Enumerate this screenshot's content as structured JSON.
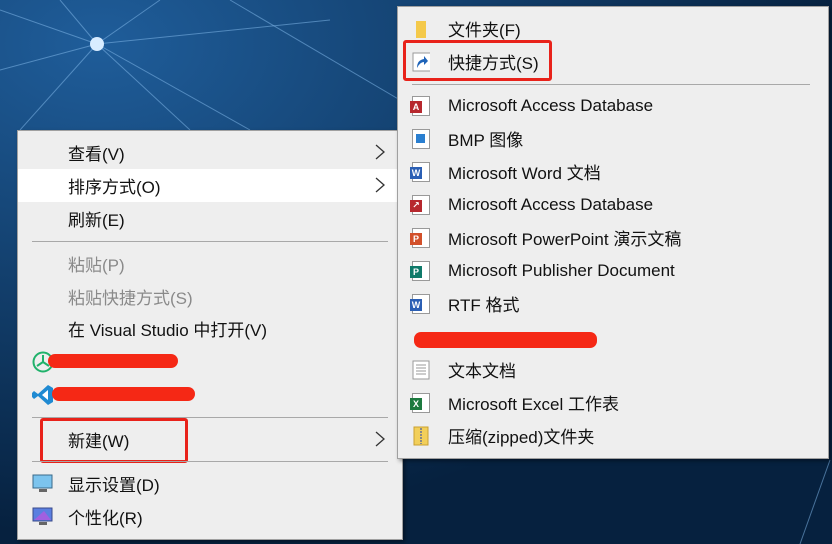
{
  "context_menu": {
    "items": [
      {
        "label": "查看(V)",
        "submenu": true
      },
      {
        "label": "排序方式(O)",
        "submenu": true,
        "highlighted": true
      },
      {
        "label": "刷新(E)"
      },
      {
        "label": "粘贴(P)",
        "disabled": true
      },
      {
        "label": "粘贴快捷方式(S)",
        "disabled": true
      },
      {
        "label": "在 Visual Studio 中打开(V)"
      },
      {
        "label": "",
        "redacted": true,
        "icon": "app-green-icon"
      },
      {
        "label": "",
        "redacted": true,
        "icon": "vscode-icon"
      },
      {
        "label": "新建(W)",
        "submenu": true,
        "annotated": true
      },
      {
        "label": "显示设置(D)",
        "icon": "monitor-icon"
      },
      {
        "label": "个性化(R)",
        "icon": "personalize-icon"
      }
    ]
  },
  "new_submenu": {
    "items": [
      {
        "label": "文件夹(F)",
        "icon": "folder-icon"
      },
      {
        "label": "快捷方式(S)",
        "icon": "shortcut-icon",
        "annotated": true
      },
      {
        "label": "Microsoft Access Database",
        "icon": "access-icon"
      },
      {
        "label": "BMP 图像",
        "icon": "bmp-icon"
      },
      {
        "label": "Microsoft Word 文档",
        "icon": "word-icon"
      },
      {
        "label": "Microsoft Access Database",
        "icon": "access-shortcut-icon"
      },
      {
        "label": "Microsoft PowerPoint 演示文稿",
        "icon": "powerpoint-icon"
      },
      {
        "label": "Microsoft Publisher Document",
        "icon": "publisher-icon"
      },
      {
        "label": "RTF 格式",
        "icon": "rtf-icon"
      },
      {
        "label": "",
        "redacted": true
      },
      {
        "label": "文本文档",
        "icon": "text-document-icon"
      },
      {
        "label": "Microsoft Excel 工作表",
        "icon": "excel-icon"
      },
      {
        "label": "压缩(zipped)文件夹",
        "icon": "zip-folder-icon"
      }
    ]
  },
  "colors": {
    "annotation": "#e8221a",
    "menu_bg": "#eeeeee",
    "highlight": "#ffffff"
  }
}
